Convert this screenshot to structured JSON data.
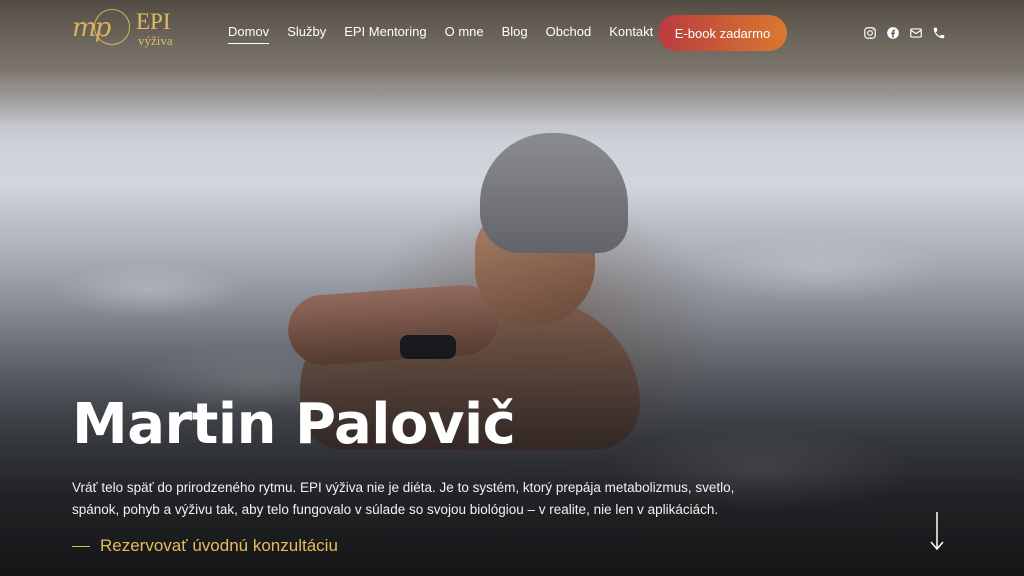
{
  "brand": {
    "mark": "mp",
    "name": "EPI",
    "sub": "výživa",
    "gold": "#e1bc66"
  },
  "nav": {
    "items": [
      {
        "label": "Domov",
        "active": true
      },
      {
        "label": "Služby",
        "active": false
      },
      {
        "label": "EPI Mentoring",
        "active": false
      },
      {
        "label": "O mne",
        "active": false
      },
      {
        "label": "Blog",
        "active": false
      },
      {
        "label": "Obchod",
        "active": false
      },
      {
        "label": "Kontakt",
        "active": false
      }
    ],
    "cta_label": "E-book zadarmo",
    "cta_colors": [
      "#b93b3f",
      "#d9792f"
    ]
  },
  "social": {
    "icons": [
      "instagram-icon",
      "facebook-icon",
      "mail-icon",
      "phone-icon"
    ]
  },
  "hero": {
    "title": "Martin Palovič",
    "description": "Vráť telo späť do prirodzeného rytmu. EPI výživa nie je diéta. Je to systém, ktorý prepája metabolizmus, svetlo, spánok, pohyb a výživu tak, aby telo fungovalo v súlade so svojou biológiou – v realite, nie len v aplikáciách.",
    "cta_label": "Rezervovať úvodnú konzultáciu",
    "scroll_icon": "arrow-down-icon"
  }
}
